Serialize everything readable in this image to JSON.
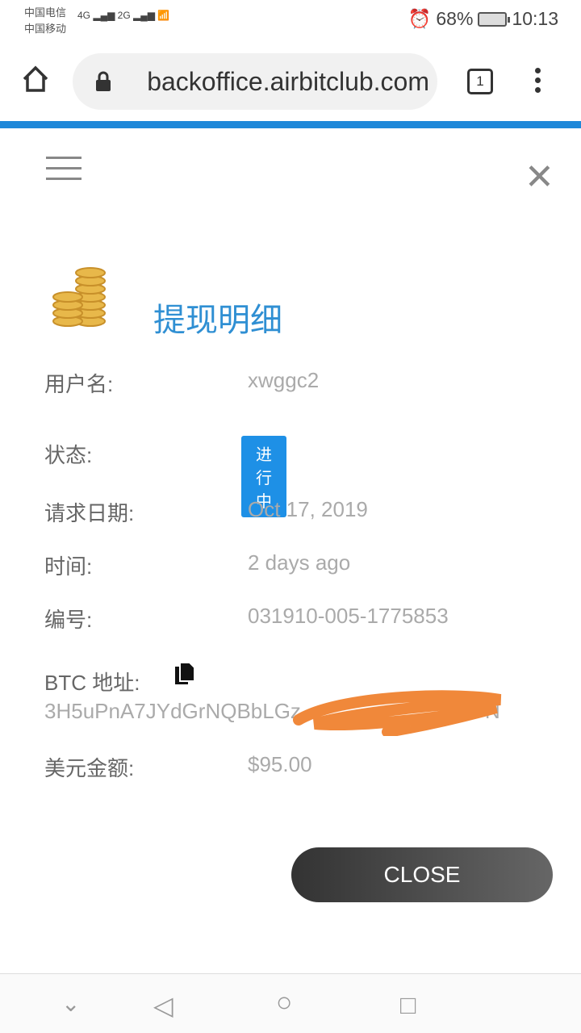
{
  "status_bar": {
    "carrier1": "中国电信",
    "carrier2": "中国移动",
    "net1": "4G",
    "net2": "2G",
    "battery": "68%",
    "time": "10:13"
  },
  "browser": {
    "url": "backoffice.airbitclub.com",
    "tab_count": "1"
  },
  "colors": {
    "accent": "#2f8fd3",
    "badge": "#1e90e6",
    "scribble": "#f0883a"
  },
  "dialog": {
    "title": "提现明细",
    "fields": [
      {
        "label": "用户名:",
        "value": "xwggc2"
      },
      {
        "label": "状态:",
        "value": "进行中"
      },
      {
        "label": "请求日期:",
        "value": "Oct 17, 2019"
      },
      {
        "label": "时间:",
        "value": "2 days ago"
      },
      {
        "label": "编号:",
        "value": "031910-005-1775853"
      },
      {
        "label": "BTC 地址:",
        "value_visible_start": "3H5uPnA7JYdGrNQBbLGz",
        "value_visible_end": "N"
      },
      {
        "label": "美元金额:",
        "value": "$95.00"
      }
    ],
    "close_label": "CLOSE"
  }
}
